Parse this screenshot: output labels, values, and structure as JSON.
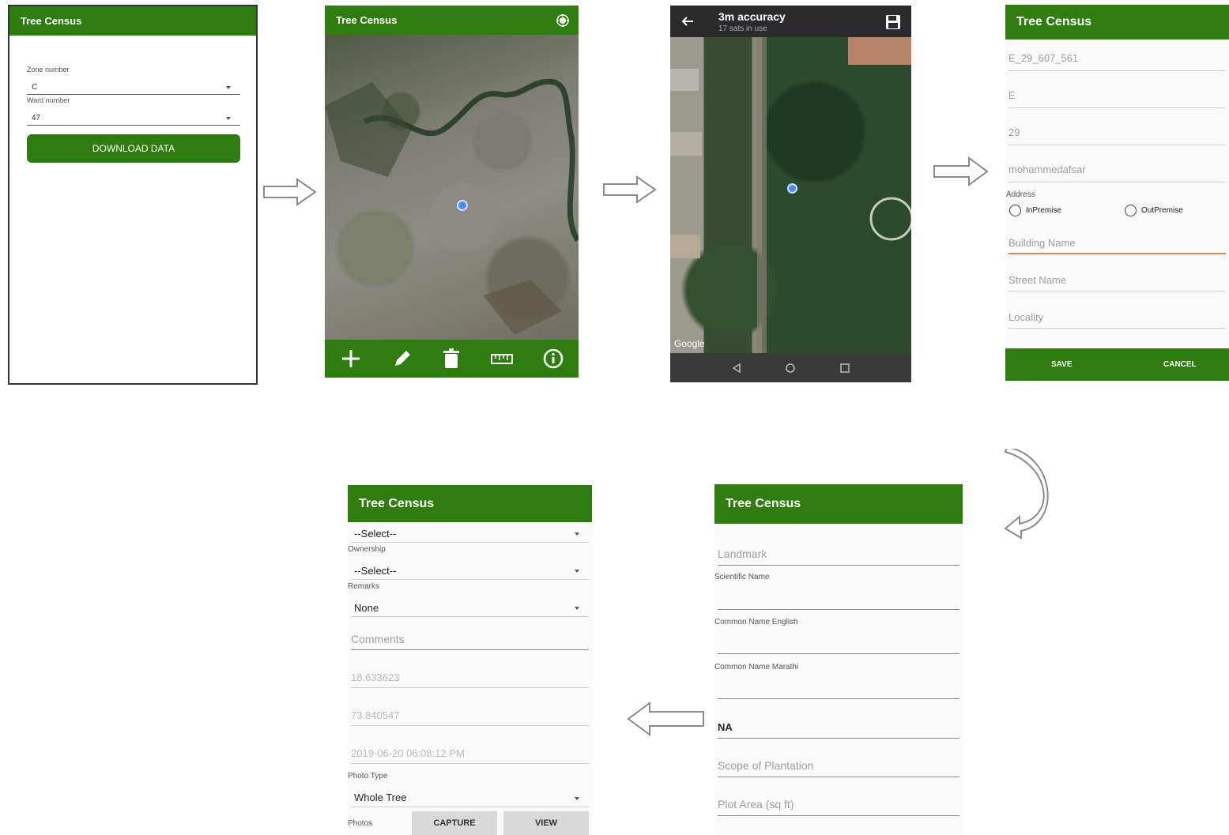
{
  "s1": {
    "title": "Tree Census",
    "zone_label": "Zone number",
    "zone_value": "C",
    "ward_label": "Ward number",
    "ward_value": "47",
    "download_label": "DOWNLOAD DATA"
  },
  "s2": {
    "title": "Tree Census",
    "toolbar": [
      "add-icon",
      "edit-icon",
      "delete-icon",
      "measure-icon",
      "info-icon"
    ]
  },
  "s3": {
    "accuracy": "3m accuracy",
    "sats": "17 sats in use",
    "google": "Google"
  },
  "s4": {
    "title": "Tree Census",
    "field1": "E_29_607_561",
    "field2": "E",
    "field3": "29",
    "field4": "mohammedafsar",
    "address_label": "Address",
    "radio_in": "InPremise",
    "radio_out": "OutPremise",
    "building_ph": "Building Name",
    "street_ph": "Street Name",
    "locality_ph": "Locality",
    "save": "SAVE",
    "cancel": "CANCEL"
  },
  "s5": {
    "title": "Tree Census",
    "landmark_ph": "Landmark",
    "sci_label": "Scientific Name",
    "eng_label": "Common Name English",
    "mar_label": "Common Name Marathi",
    "na_value": "NA",
    "scope_ph": "Scope of Plantation",
    "plot_ph": "Plot Area (sq ft)"
  },
  "s6": {
    "title": "Tree Census",
    "select1": "--Select--",
    "ownership_label": "Ownership",
    "select2": "--Select--",
    "remarks_label": "Remarks",
    "remarks_value": "None",
    "comments_ph": "Comments",
    "lat": "18.633623",
    "lon": "73.840547",
    "datetime": "2019-06-20 06:08:12 PM",
    "phototype_label": "Photo Type",
    "phototype_value": "Whole Tree",
    "photos_label": "Photos",
    "capture": "CAPTURE",
    "view": "VIEW"
  },
  "colors": {
    "green": "#2e7d0e",
    "outline_arrow": "#8a8a8a",
    "underline_active": "#d98a5a"
  }
}
